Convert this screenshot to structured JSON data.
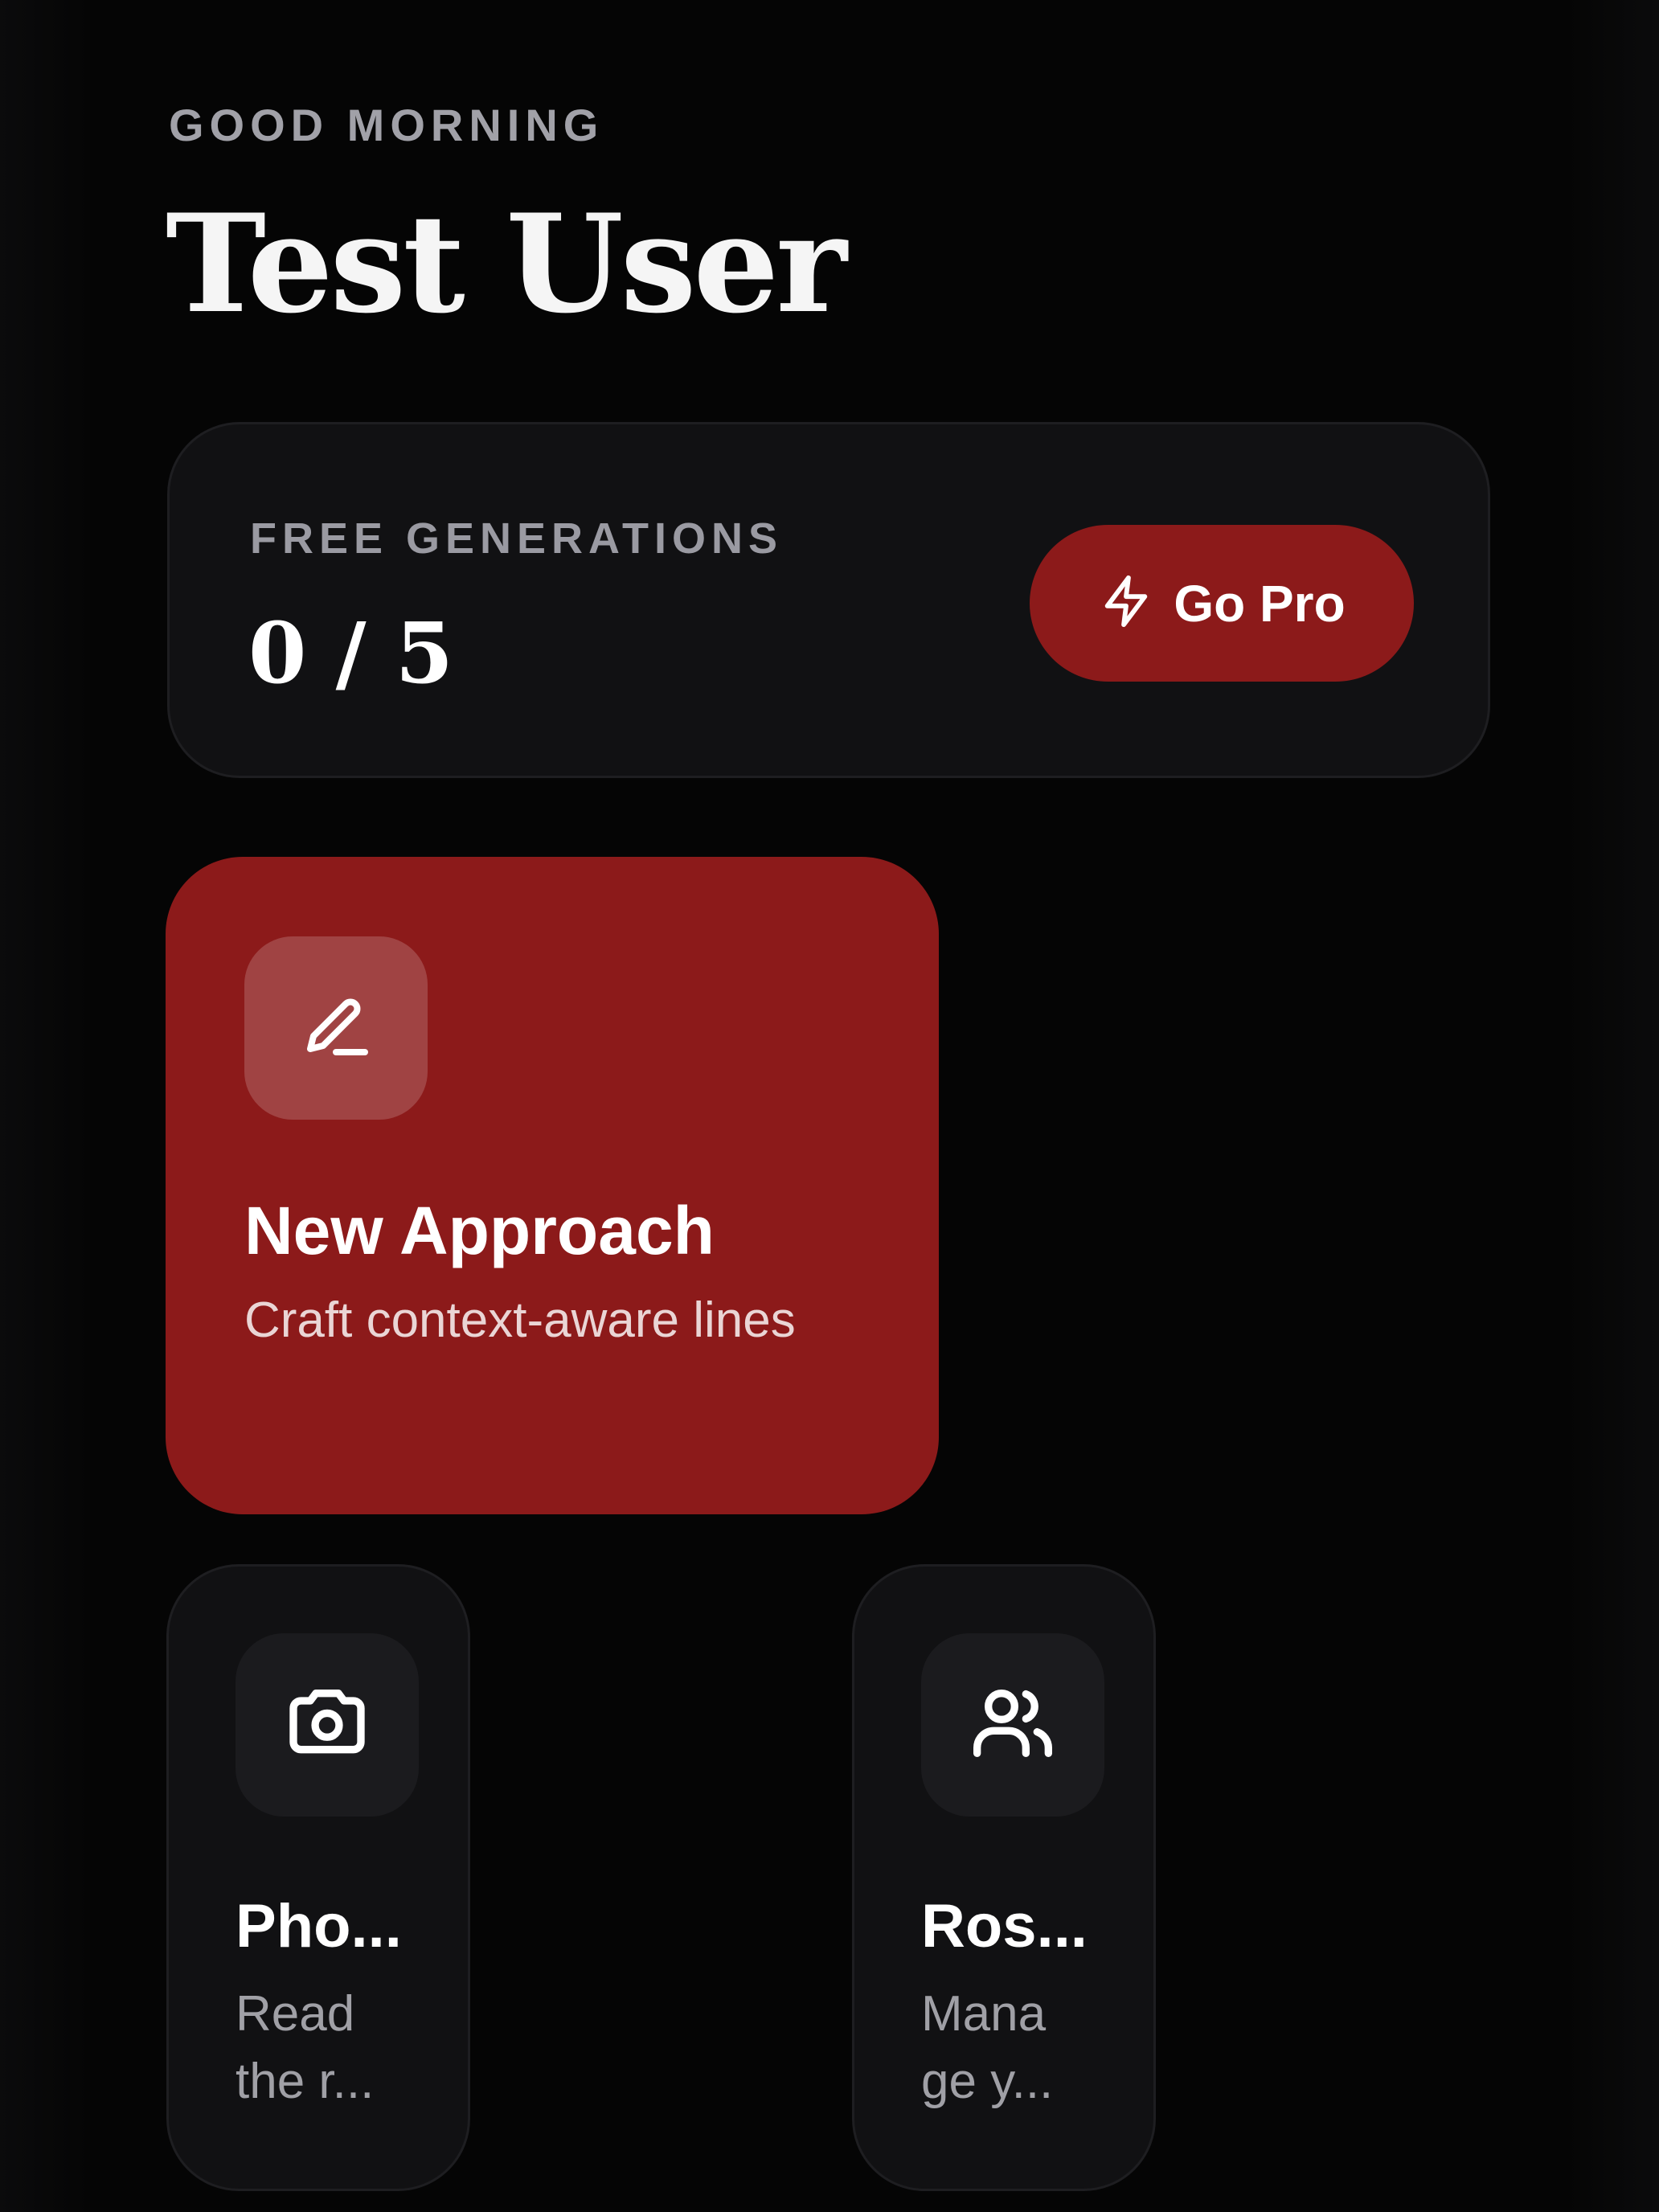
{
  "header": {
    "greeting": "GOOD MORNING",
    "user_name": "Test User"
  },
  "generations": {
    "label": "FREE GENERATIONS",
    "count_text": "0 / 5",
    "used": 0,
    "total": 5,
    "go_pro_label": "Go Pro",
    "go_pro_icon": "lightning-icon"
  },
  "features": {
    "main": {
      "icon": "pencil-icon",
      "title": "New Approach",
      "subtitle": "Craft context-aware lines"
    },
    "photo": {
      "icon": "camera-icon",
      "title": "Pho...",
      "subtitle_line1": "Read",
      "subtitle_line2": "the r..."
    },
    "roster": {
      "icon": "users-icon",
      "title": "Ros...",
      "subtitle_line1": "Mana",
      "subtitle_line2": "ge y..."
    }
  },
  "colors": {
    "accent": "#8c1a1a",
    "background": "#050505",
    "card": "#111113",
    "muted_text": "#a1a1a8"
  }
}
